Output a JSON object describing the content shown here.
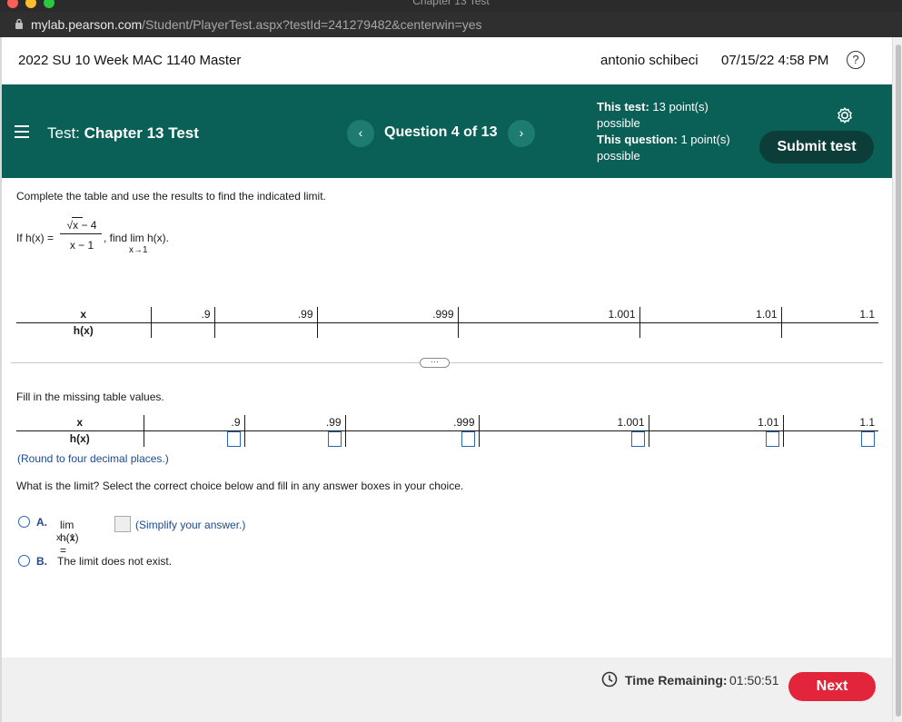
{
  "browser": {
    "window_title": "Chapter 13 Test",
    "url_host": "mylab.pearson.com",
    "url_path": "/Student/PlayerTest.aspx?testId=241279482&centerwin=yes"
  },
  "course_bar": {
    "course": "2022 SU 10 Week MAC 1140 Master",
    "user": "antonio schibeci",
    "datetime": "07/15/22 4:58 PM",
    "help": "?"
  },
  "test_bar": {
    "test_prefix": "Test:",
    "test_name": "Chapter 13 Test",
    "question": "Question 4 of 13",
    "prev": "‹",
    "next": "›",
    "points_test_label": "This test:",
    "points_test_value": "13 point(s) possible",
    "points_question_label": "This question:",
    "points_question_value": "1 point(s) possible",
    "submit": "Submit test"
  },
  "question": {
    "instruction": "Complete the table and use the results to find the indicated limit.",
    "if_text": "If h(x) =",
    "numerator": "√x − 4",
    "denominator": "x − 1",
    "find_text": ", find  lim  h(x).",
    "lim_sub": "x→1",
    "table_x_label": "x",
    "table_h_label": "h(x)",
    "x_values": [
      ".9",
      ".99",
      ".999",
      "1.001",
      "1.01",
      "1.1"
    ],
    "expand": "···",
    "fill_instruction": "Fill in the missing table values.",
    "round_note": "(Round to four decimal places.)",
    "limit_question": "What is the limit? Select the correct choice below and fill in any answer boxes in your choice.",
    "choice_a_letter": "A.",
    "choice_a_lim": "lim  h(x) =",
    "choice_a_sub": "x→1",
    "choice_a_note": "(Simplify your answer.)",
    "choice_b_letter": "B.",
    "choice_b_text": "The limit does not exist."
  },
  "footer": {
    "time_label": "Time Remaining:",
    "time_value": "01:50:51",
    "next": "Next"
  },
  "colors": {
    "header_teal": "#0a5f56",
    "submit_dark": "#0c3d38",
    "next_red": "#e3253b",
    "link_blue": "#1c4a8e"
  }
}
